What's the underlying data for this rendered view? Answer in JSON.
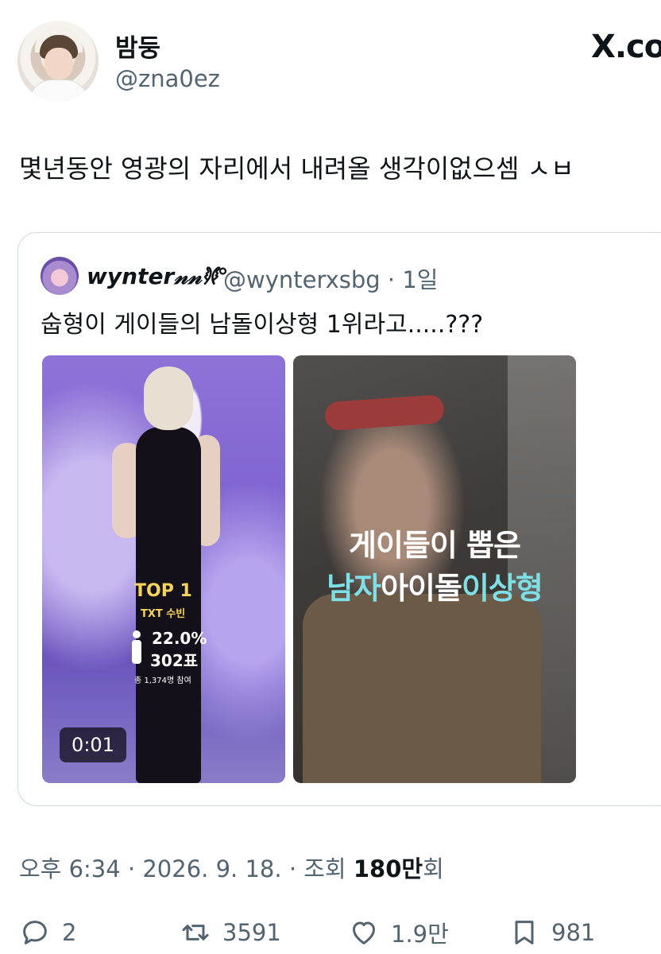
{
  "author": {
    "display_name": "밤둥",
    "handle": "@zna0ez"
  },
  "brand": {
    "logo_text": "X.co"
  },
  "tweet": {
    "text": "몇년동안 영광의 자리에서 내려올 생각이없으셈 ㅅㅂ"
  },
  "quoted_tweet": {
    "author_name": "wynter𝓃𝓃𐦍°",
    "handle_time": "@wynterxsbg · 1일",
    "text": "숩형이 게이들의 남돌이상형 1위라고.....???",
    "media": [
      {
        "kind": "video",
        "duration": "0:01",
        "overlay": {
          "rank": "TOP 1",
          "name": "TXT 수빈",
          "percent": "22.0%",
          "votes": "302표",
          "total": "총 1,374명 참여"
        }
      },
      {
        "kind": "image",
        "overlay_line1": "게이들이 뽑은",
        "overlay_line2_a": "남자",
        "overlay_line2_b": "아이돌",
        "overlay_line2_c": "이상형"
      }
    ]
  },
  "meta": {
    "time_date": "오후 6:34 · 2026. 9. 18. · 조회 ",
    "views": "180만",
    "views_suffix": "회"
  },
  "actions": {
    "replies": "2",
    "retweets": "3591",
    "likes": "1.9만",
    "bookmarks": "981",
    "icons": [
      "reply-icon",
      "retweet-icon",
      "like-icon",
      "bookmark-icon"
    ]
  }
}
